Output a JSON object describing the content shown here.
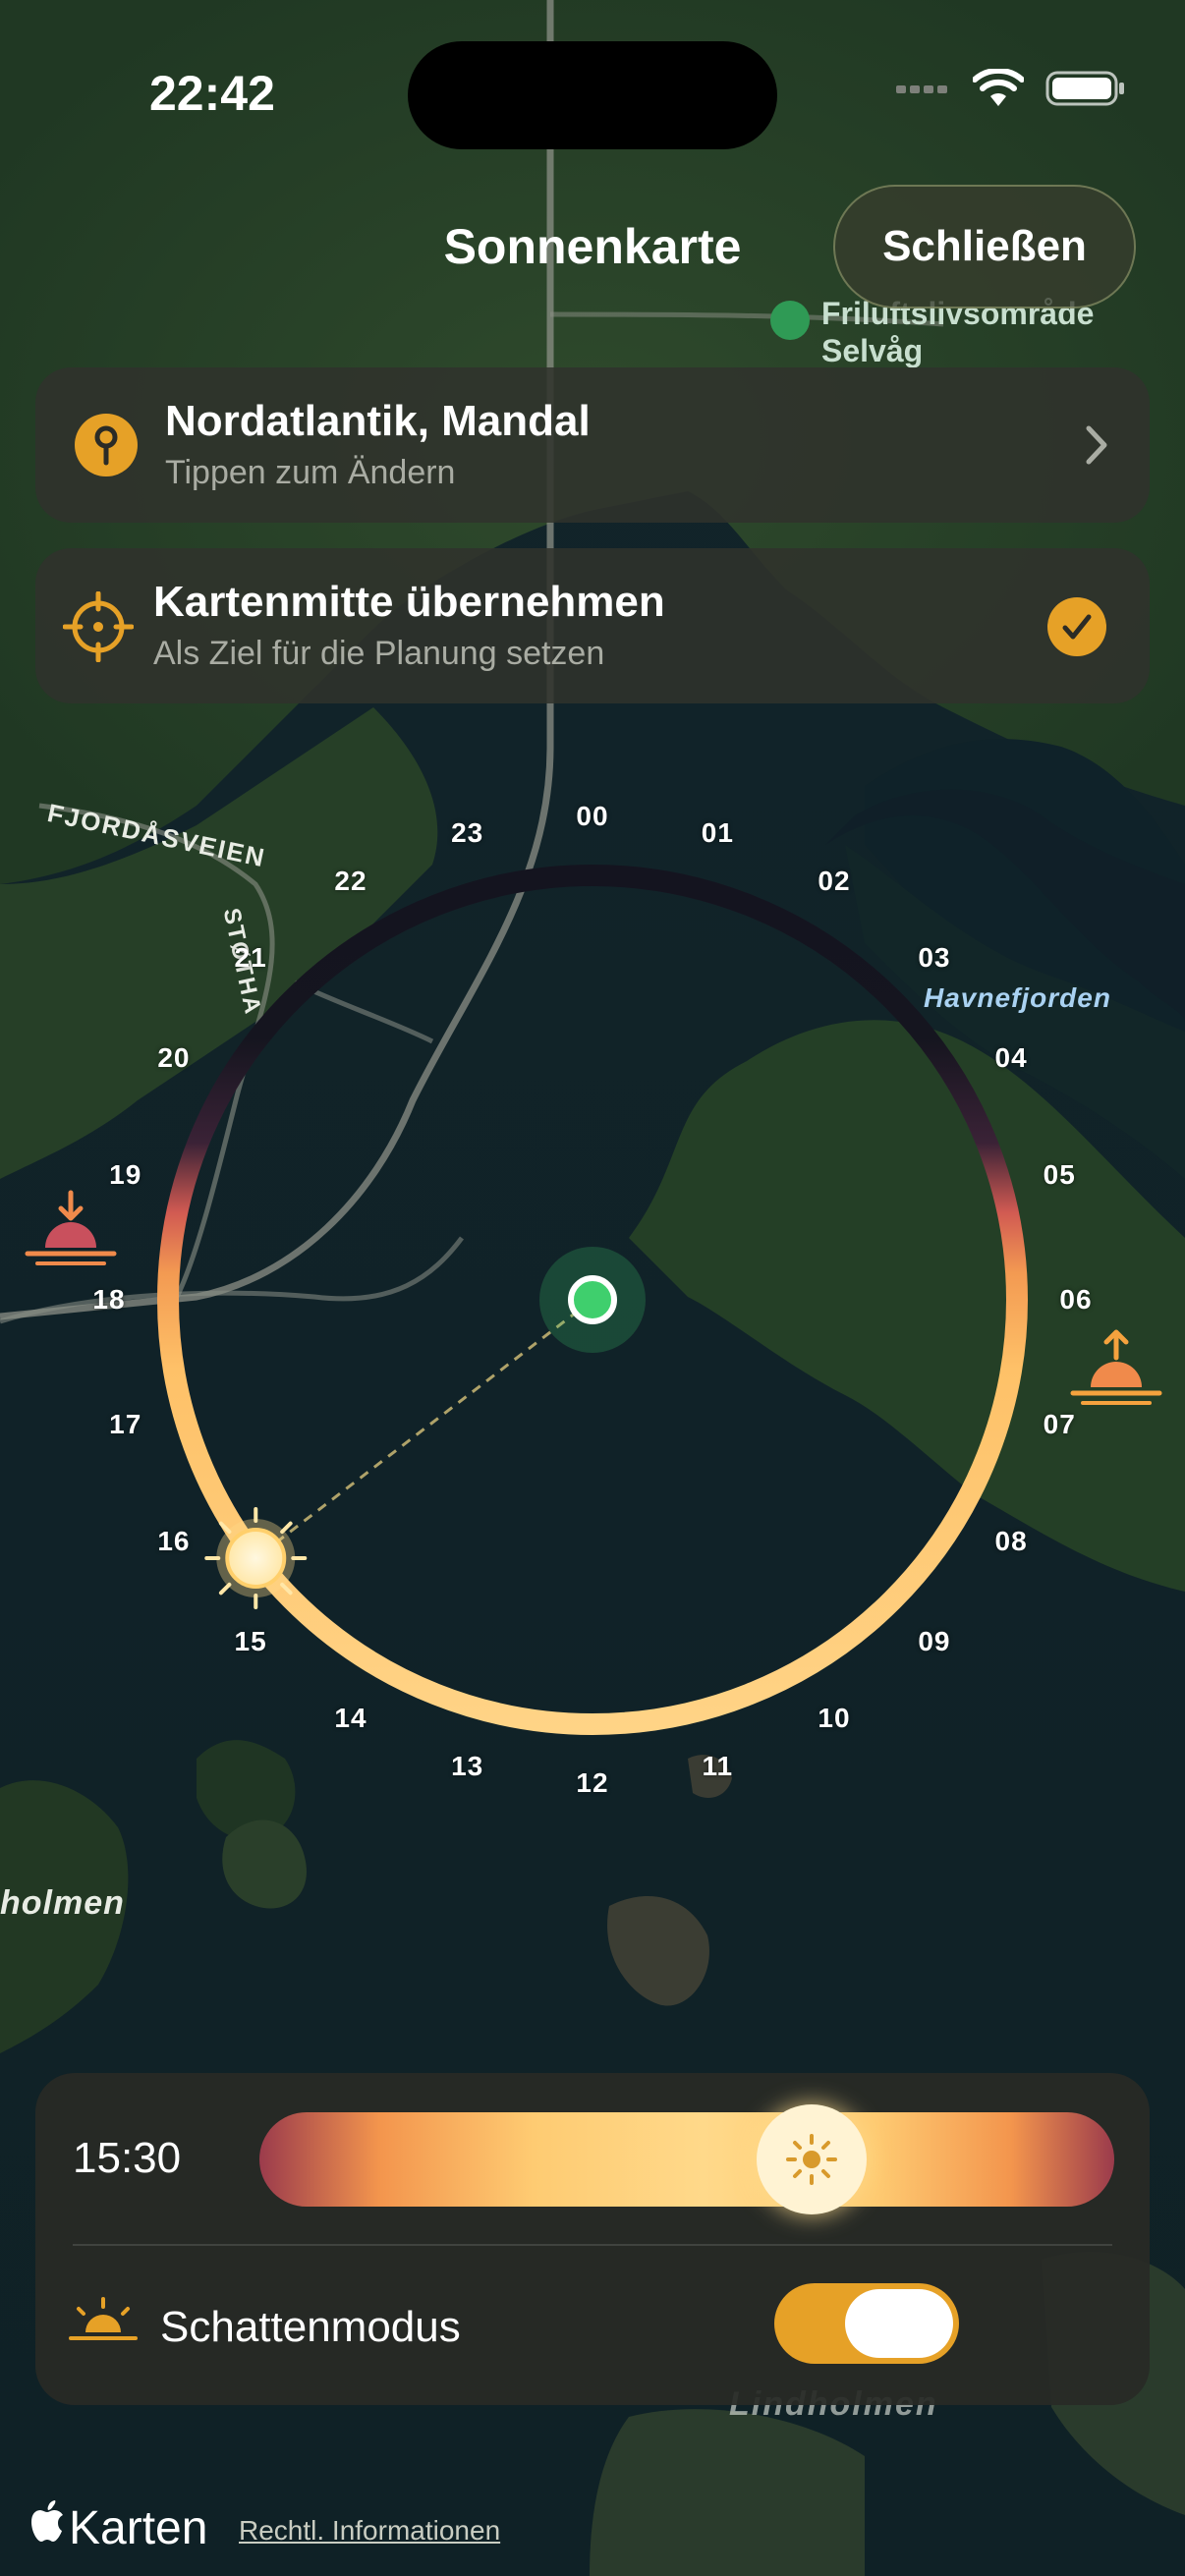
{
  "status_bar": {
    "time": "22:42"
  },
  "header": {
    "title": "Sonnenkarte",
    "close_label": "Schließen"
  },
  "map_labels": {
    "poi_name": "Friluftsliv­sområde Selvåg",
    "road_1": "FJORDÅSVEIEN",
    "road_2": "STØTHA",
    "water_1": "Havnefjorden",
    "island_1": "holmen",
    "island_2": "Lindholmen"
  },
  "location_card": {
    "title": "Nordatlantik, Mandal",
    "subtitle": "Tippen zum Ändern",
    "icon": "pin-icon"
  },
  "center_card": {
    "title": "Kartenmitte übernehmen",
    "subtitle": "Als Ziel für die Planung setzen",
    "icon": "crosshair-icon",
    "checked": true
  },
  "sun_dial": {
    "hours": [
      "00",
      "01",
      "02",
      "03",
      "04",
      "05",
      "06",
      "07",
      "08",
      "09",
      "10",
      "11",
      "12",
      "13",
      "14",
      "15",
      "16",
      "17",
      "18",
      "19",
      "20",
      "21",
      "22",
      "23"
    ],
    "sunrise_icon": "sunrise-icon",
    "sunset_icon": "sunset-icon",
    "sun_icon": "sun-icon",
    "current_hour": 15.5
  },
  "time_panel": {
    "time": "15:30",
    "slider_value": 0.646,
    "shadow_mode_label": "Schattenmodus",
    "shadow_mode_on": true
  },
  "footer": {
    "brand": "Karten",
    "legal": "Rechtl. Informationen"
  },
  "colors": {
    "accent": "#e6a127",
    "location_dot": "#3fcf6d",
    "night": "#161624",
    "day": "#fecb72"
  }
}
